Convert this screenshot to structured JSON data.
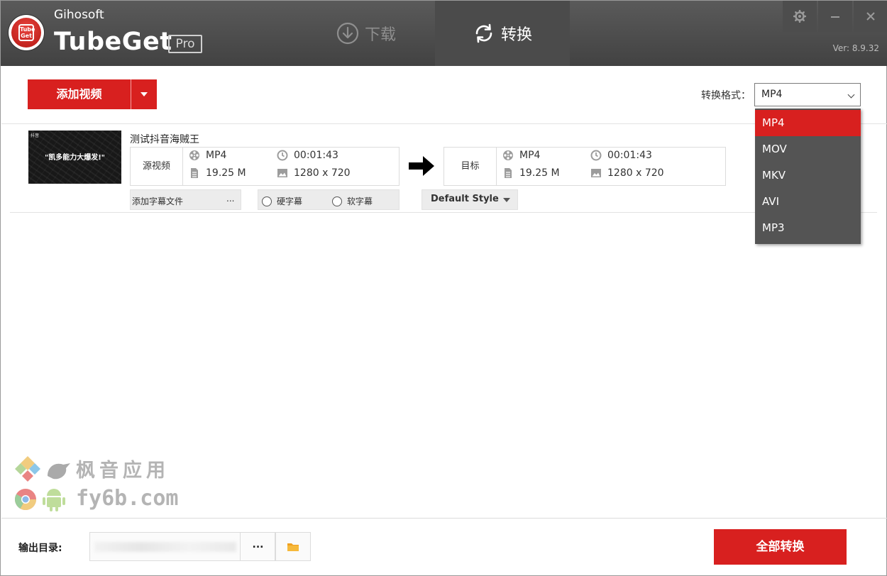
{
  "app": {
    "brand": "Gihosoft",
    "product": "TubeGet",
    "edition_badge": "Pro",
    "logo_text_line1": "Tube",
    "logo_text_line2": "Get",
    "version": "Ver: 8.9.32"
  },
  "tabs": [
    {
      "label": "下载",
      "icon": "download-icon",
      "active": false
    },
    {
      "label": "转换",
      "icon": "refresh-icon",
      "active": true
    }
  ],
  "window_controls": [
    "gear-icon",
    "minimize-icon",
    "close-icon"
  ],
  "toolbar": {
    "add_video_label": "添加视频",
    "format_label": "转换格式：",
    "format_selected": "MP4"
  },
  "format_dropdown": {
    "options": [
      "MP4",
      "MOV",
      "MKV",
      "AVI",
      "MP3"
    ],
    "selected_index": 0
  },
  "task": {
    "thumbnail_watermark": "抖音",
    "thumbnail_caption": "\"凯多能力大爆发!\"",
    "title": "测试抖音海贼王",
    "source": {
      "tag": "源视频",
      "format": "MP4",
      "duration": "00:01:43",
      "size": "19.25 M",
      "resolution": "1280 x 720"
    },
    "target": {
      "tag": "目标",
      "format": "MP4",
      "duration": "00:01:43",
      "size": "19.25 M",
      "resolution": "1280 x 720"
    },
    "subtitle_label": "添加字幕文件",
    "subtitle_more": "...",
    "hard_subtitle": "硬字幕",
    "soft_subtitle": "软字幕",
    "style_selected": "Default Style"
  },
  "watermark": {
    "line1": "枫音应用",
    "line2": "fy6b.com"
  },
  "footer": {
    "output_label": "输出目录:",
    "browse_label": "...",
    "convert_all_label": "全部转换"
  },
  "colors": {
    "accent_red": "#d8201f",
    "titlebar": "#4a4a4a",
    "dropdown_bg": "#545454"
  }
}
